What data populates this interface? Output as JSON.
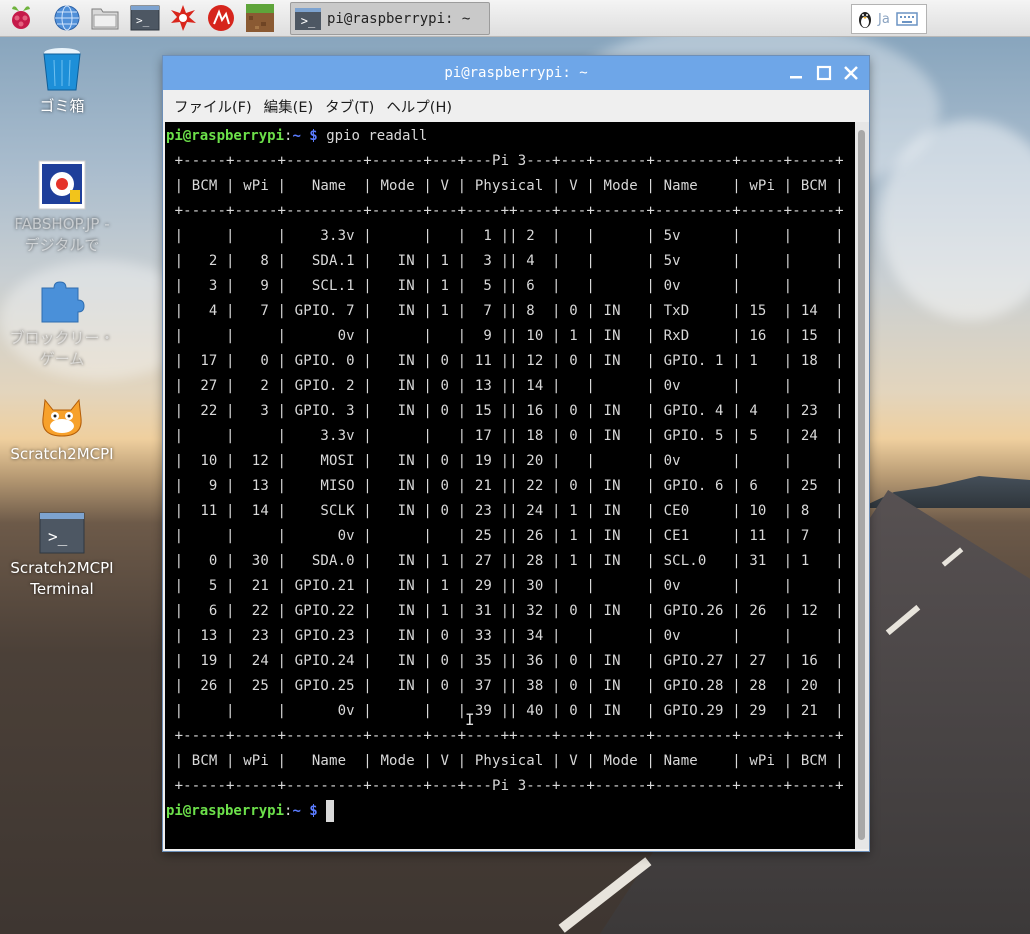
{
  "taskbar": {
    "launchers": [
      "raspberry-menu-icon",
      "web-browser-icon",
      "file-manager-icon",
      "terminal-icon",
      "wolfram-icon",
      "mathematica-icon",
      "minecraft-icon"
    ],
    "task": {
      "label": "pi@raspberrypi: ~"
    },
    "tray": {
      "lang": "Ja"
    }
  },
  "desktop": {
    "icons": [
      {
        "label": "ゴミ箱",
        "icon": "trash-icon"
      },
      {
        "label": "FABSHOP.JP - デジタルで",
        "icon": "fabshop-icon"
      },
      {
        "label": "ブロックリー・ゲーム",
        "icon": "puzzle-icon"
      },
      {
        "label": "Scratch2MCPI",
        "icon": "scratch-cat-icon"
      },
      {
        "label": "Scratch2MCPI Terminal",
        "icon": "terminal-icon"
      }
    ]
  },
  "window": {
    "title": "pi@raspberrypi: ~",
    "menu": [
      "ファイル(F)",
      "編集(E)",
      "タブ(T)",
      "ヘルプ(H)"
    ],
    "prompt": {
      "user": "pi@raspberrypi",
      "sep": ":",
      "path": "~ $",
      "command": "gpio readall"
    },
    "table": [
      " +-----+-----+---------+------+---+---Pi 3---+---+------+---------+-----+-----+",
      " | BCM | wPi |   Name  | Mode | V | Physical | V | Mode | Name    | wPi | BCM |",
      " +-----+-----+---------+------+---+----++----+---+------+---------+-----+-----+",
      " |     |     |    3.3v |      |   |  1 || 2  |   |      | 5v      |     |     |",
      " |   2 |   8 |   SDA.1 |   IN | 1 |  3 || 4  |   |      | 5v      |     |     |",
      " |   3 |   9 |   SCL.1 |   IN | 1 |  5 || 6  |   |      | 0v      |     |     |",
      " |   4 |   7 | GPIO. 7 |   IN | 1 |  7 || 8  | 0 | IN   | TxD     | 15  | 14  |",
      " |     |     |      0v |      |   |  9 || 10 | 1 | IN   | RxD     | 16  | 15  |",
      " |  17 |   0 | GPIO. 0 |   IN | 0 | 11 || 12 | 0 | IN   | GPIO. 1 | 1   | 18  |",
      " |  27 |   2 | GPIO. 2 |   IN | 0 | 13 || 14 |   |      | 0v      |     |     |",
      " |  22 |   3 | GPIO. 3 |   IN | 0 | 15 || 16 | 0 | IN   | GPIO. 4 | 4   | 23  |",
      " |     |     |    3.3v |      |   | 17 || 18 | 0 | IN   | GPIO. 5 | 5   | 24  |",
      " |  10 |  12 |    MOSI |   IN | 0 | 19 || 20 |   |      | 0v      |     |     |",
      " |   9 |  13 |    MISO |   IN | 0 | 21 || 22 | 0 | IN   | GPIO. 6 | 6   | 25  |",
      " |  11 |  14 |    SCLK |   IN | 0 | 23 || 24 | 1 | IN   | CE0     | 10  | 8   |",
      " |     |     |      0v |      |   | 25 || 26 | 1 | IN   | CE1     | 11  | 7   |",
      " |   0 |  30 |   SDA.0 |   IN | 1 | 27 || 28 | 1 | IN   | SCL.0   | 31  | 1   |",
      " |   5 |  21 | GPIO.21 |   IN | 1 | 29 || 30 |   |      | 0v      |     |     |",
      " |   6 |  22 | GPIO.22 |   IN | 1 | 31 || 32 | 0 | IN   | GPIO.26 | 26  | 12  |",
      " |  13 |  23 | GPIO.23 |   IN | 0 | 33 || 34 |   |      | 0v      |     |     |",
      " |  19 |  24 | GPIO.24 |   IN | 0 | 35 || 36 | 0 | IN   | GPIO.27 | 27  | 16  |",
      " |  26 |  25 | GPIO.25 |   IN | 0 | 37 || 38 | 0 | IN   | GPIO.28 | 28  | 20  |",
      " |     |     |      0v |      |   | 39 || 40 | 0 | IN   | GPIO.29 | 29  | 21  |",
      " +-----+-----+---------+------+---+----++----+---+------+---------+-----+-----+",
      " | BCM | wPi |   Name  | Mode | V | Physical | V | Mode | Name    | wPi | BCM |",
      " +-----+-----+---------+------+---+---Pi 3---+---+------+---------+-----+-----+"
    ]
  },
  "colors": {
    "titlebar": "#6ea6e8",
    "prompt_user": "#6ce04a",
    "prompt_path": "#5b7cff",
    "terminal_bg": "#000000"
  }
}
